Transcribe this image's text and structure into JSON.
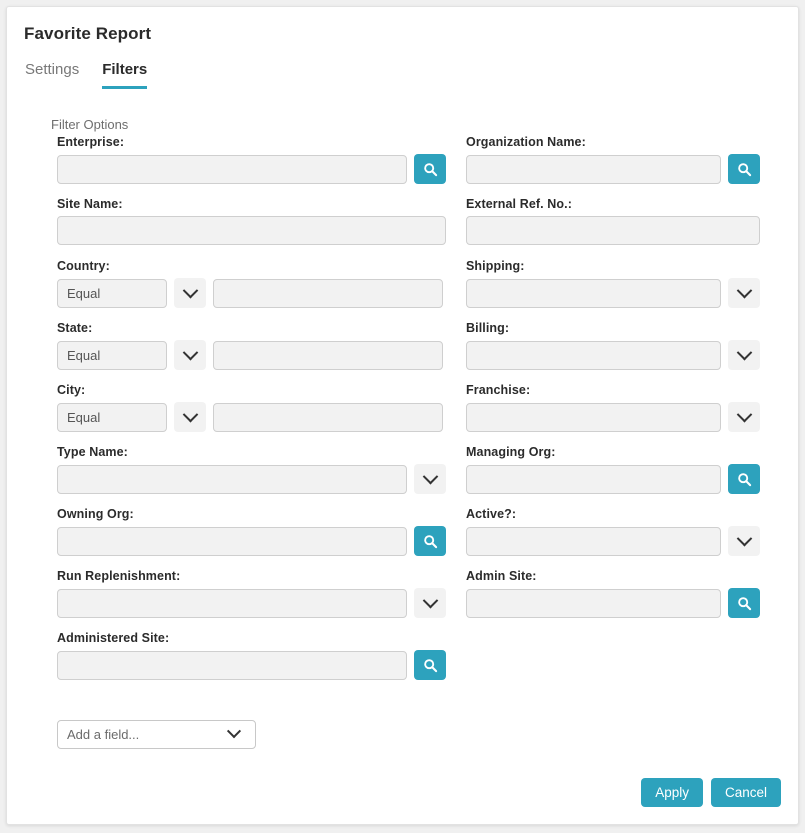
{
  "page": {
    "title": "Favorite Report"
  },
  "tabs": [
    {
      "label": "Settings",
      "active": false
    },
    {
      "label": "Filters",
      "active": true
    }
  ],
  "section": {
    "label": "Filter Options"
  },
  "icons": {
    "search": "search-icon",
    "chevron_down": "chevron-down-icon"
  },
  "colors": {
    "accent": "#2da2bd",
    "input_bg": "#f2f2f2",
    "input_border": "#cfcfcf",
    "label_text": "#2b2b2b",
    "muted_text": "#6e6e6e"
  },
  "fields": {
    "enterprise": {
      "label": "Enterprise:",
      "value": "",
      "placeholder": "",
      "control": "search"
    },
    "organization_name": {
      "label": "Organization Name:",
      "value": "",
      "placeholder": "",
      "control": "search"
    },
    "site_name": {
      "label": "Site Name:",
      "value": "",
      "placeholder": "",
      "control": "none"
    },
    "external_ref_no": {
      "label": "External Ref. No.:",
      "value": "",
      "placeholder": "",
      "control": "none"
    },
    "country": {
      "label": "Country:",
      "operator": "Equal",
      "value": "",
      "placeholder": "",
      "control": "operator"
    },
    "shipping": {
      "label": "Shipping:",
      "value": "",
      "placeholder": "",
      "control": "chevron"
    },
    "state": {
      "label": "State:",
      "operator": "Equal",
      "value": "",
      "placeholder": "",
      "control": "operator"
    },
    "billing": {
      "label": "Billing:",
      "value": "",
      "placeholder": "",
      "control": "chevron"
    },
    "city": {
      "label": "City:",
      "operator": "Equal",
      "value": "",
      "placeholder": "",
      "control": "operator"
    },
    "franchise": {
      "label": "Franchise:",
      "value": "",
      "placeholder": "",
      "control": "chevron"
    },
    "type_name": {
      "label": "Type Name:",
      "value": "",
      "placeholder": "",
      "control": "chevron"
    },
    "managing_org": {
      "label": "Managing Org:",
      "value": "",
      "placeholder": "",
      "control": "search"
    },
    "owning_org": {
      "label": "Owning Org:",
      "value": "",
      "placeholder": "",
      "control": "search"
    },
    "active": {
      "label": "Active?:",
      "value": "",
      "placeholder": "",
      "control": "chevron"
    },
    "run_replenishment": {
      "label": "Run Replenishment:",
      "value": "",
      "placeholder": "",
      "control": "chevron"
    },
    "admin_site": {
      "label": "Admin Site:",
      "value": "",
      "placeholder": "",
      "control": "search"
    },
    "administered_site": {
      "label": "Administered Site:",
      "value": "",
      "placeholder": "",
      "control": "search"
    }
  },
  "add_field": {
    "label": "Add a field..."
  },
  "footer": {
    "apply_label": "Apply",
    "cancel_label": "Cancel"
  }
}
